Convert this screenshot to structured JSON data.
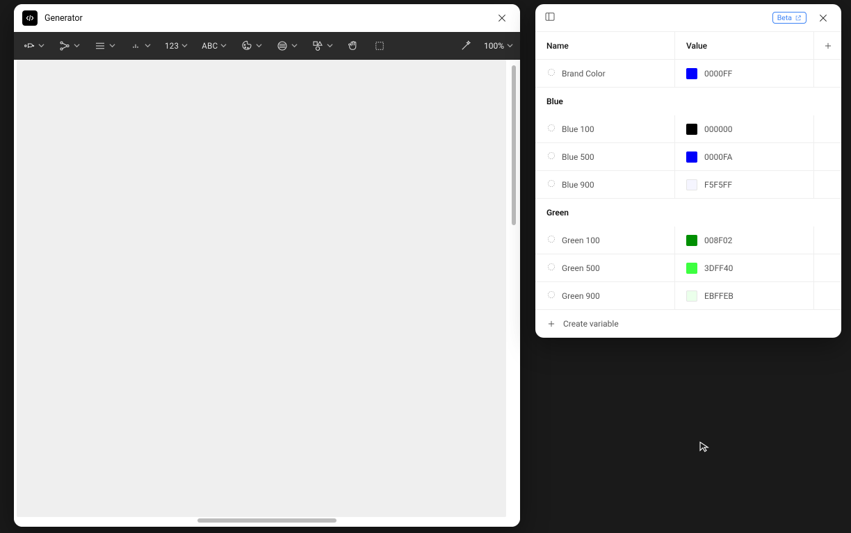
{
  "gen": {
    "title": "Generator",
    "toolbar": {
      "num_label": "123",
      "abc_label": "ABC",
      "zoom": "100%"
    }
  },
  "vars": {
    "beta_label": "Beta",
    "headers": {
      "name": "Name",
      "value": "Value"
    },
    "top_row": {
      "name": "Brand Color",
      "hex": "0000FF",
      "swatch": "#0000FF"
    },
    "groups": [
      {
        "title": "Blue",
        "rows": [
          {
            "name": "Blue 100",
            "hex": "000000",
            "swatch": "#000000"
          },
          {
            "name": "Blue 500",
            "hex": "0000FA",
            "swatch": "#0000FA"
          },
          {
            "name": "Blue 900",
            "hex": "F5F5FF",
            "swatch": "#F5F5FF",
            "bordered": true
          }
        ]
      },
      {
        "title": "Green",
        "rows": [
          {
            "name": "Green 100",
            "hex": "008F02",
            "swatch": "#008F02"
          },
          {
            "name": "Green 500",
            "hex": "3DFF40",
            "swatch": "#3DFF40"
          },
          {
            "name": "Green 900",
            "hex": "EBFFEB",
            "swatch": "#EBFFEB",
            "bordered": true
          }
        ]
      }
    ],
    "create_label": "Create variable"
  }
}
